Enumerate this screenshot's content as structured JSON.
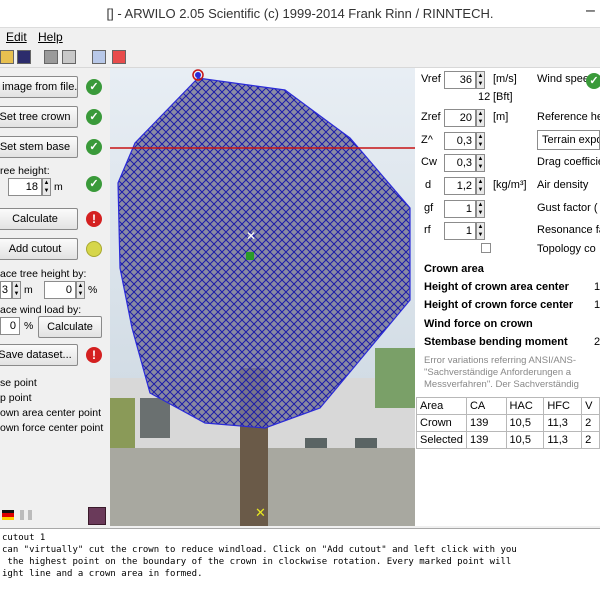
{
  "window": {
    "title": "[] - ARWILO 2.05 Scientific (c) 1999-2014 Frank Rinn / RINNTECH.",
    "min_glyph": "–"
  },
  "menu": {
    "items": [
      "Edit",
      "Help"
    ]
  },
  "toolbar": {
    "icons": [
      "open-folder-icon",
      "save-icon",
      "print-icon",
      "print-preview-icon",
      "copy-icon",
      "export-icon"
    ]
  },
  "left_panel": {
    "open_image_label": "n image from file...",
    "set_crown_label": "Set tree crown",
    "set_stem_label": "Set stem base",
    "tree_height_label": "ree height:",
    "tree_height_value": "18",
    "tree_height_unit": "m",
    "calculate_label": "Calculate",
    "add_cutout_label": "Add cutout",
    "reduce_height_label": "ace tree height by:",
    "reduce_height_m": "3",
    "reduce_height_m_unit": "m",
    "reduce_height_pct": "0",
    "reduce_height_pct_unit": "%",
    "reduce_wind_label": "ace wind load by:",
    "reduce_wind_pct": "0",
    "reduce_wind_pct_unit": "%",
    "calculate2_label": "Calculate",
    "save_dataset_label": "Save dataset...",
    "legend": [
      "se point",
      "p point",
      "own area center point",
      "own force center point"
    ],
    "flag_icons": [
      "germany-flag-icon",
      "italy-flag-icon"
    ],
    "book_icon": "book-icon",
    "status": {
      "open_image": "ok",
      "set_crown": "ok",
      "set_stem": "ok",
      "tree_height": "ok",
      "calculate": "error",
      "add_cutout": "warning",
      "save_dataset": "error"
    }
  },
  "right_panel": {
    "vref": {
      "label": "Vref",
      "value": "36",
      "unit": "[m/s]",
      "desc": "Wind speed",
      "bft": "12",
      "bft_unit": "[Bft]"
    },
    "zref": {
      "label": "Zref",
      "value": "20",
      "unit": "[m]",
      "desc": "Reference he"
    },
    "z_exp": {
      "label": "Z^",
      "value": "0,3",
      "dropdown": "Terrain expo"
    },
    "cw": {
      "label": "Cw",
      "value": "0,3",
      "desc": "Drag coefficie"
    },
    "d": {
      "label": "d",
      "value": "1,2",
      "unit": "[kg/m³]",
      "desc": "Air density"
    },
    "gf": {
      "label": "gf",
      "value": "1",
      "desc": "Gust factor ("
    },
    "rf": {
      "label": "rf",
      "value": "1",
      "desc": "Resonance fa"
    },
    "topology": {
      "label": "Topology co"
    },
    "results": {
      "crown_area": "Crown area",
      "height_area_center": "Height of crown area center",
      "height_area_center_value": "1",
      "height_force_center": "Height of crown force center",
      "height_force_center_value": "1",
      "wind_force": "Wind force on crown",
      "stembase_moment": "Stembase bending moment",
      "stembase_moment_value": "2"
    },
    "error_note": [
      "Error variations referring ANSI/ANS-",
      "\"Sachverständige Anforderungen a",
      "Messverfahren\". Der Sachverständig"
    ],
    "table": {
      "headers": [
        "Area",
        "CA",
        "HAC",
        "HFC",
        "V"
      ],
      "rows": [
        [
          "Crown",
          "139",
          "10,5",
          "11,3",
          "2"
        ],
        [
          "Selected",
          "139",
          "10,5",
          "11,3",
          "2"
        ]
      ]
    }
  },
  "status_text": [
    "cutout 1",
    "can \"virtually\" cut the crown to reduce windload. Click on \"Add cutout\" and left click with you",
    " the highest point on the boundary of the crown in clockwise rotation. Every marked point will",
    "ight line and a crown area in formed."
  ],
  "colors": {
    "crown_outline": "#2a2ad8",
    "crown_hatch": "#1c1ca8",
    "stem_line": "#c81414",
    "ok": "#3a9a3a",
    "error": "#d42020",
    "warning": "#d6d64a"
  }
}
